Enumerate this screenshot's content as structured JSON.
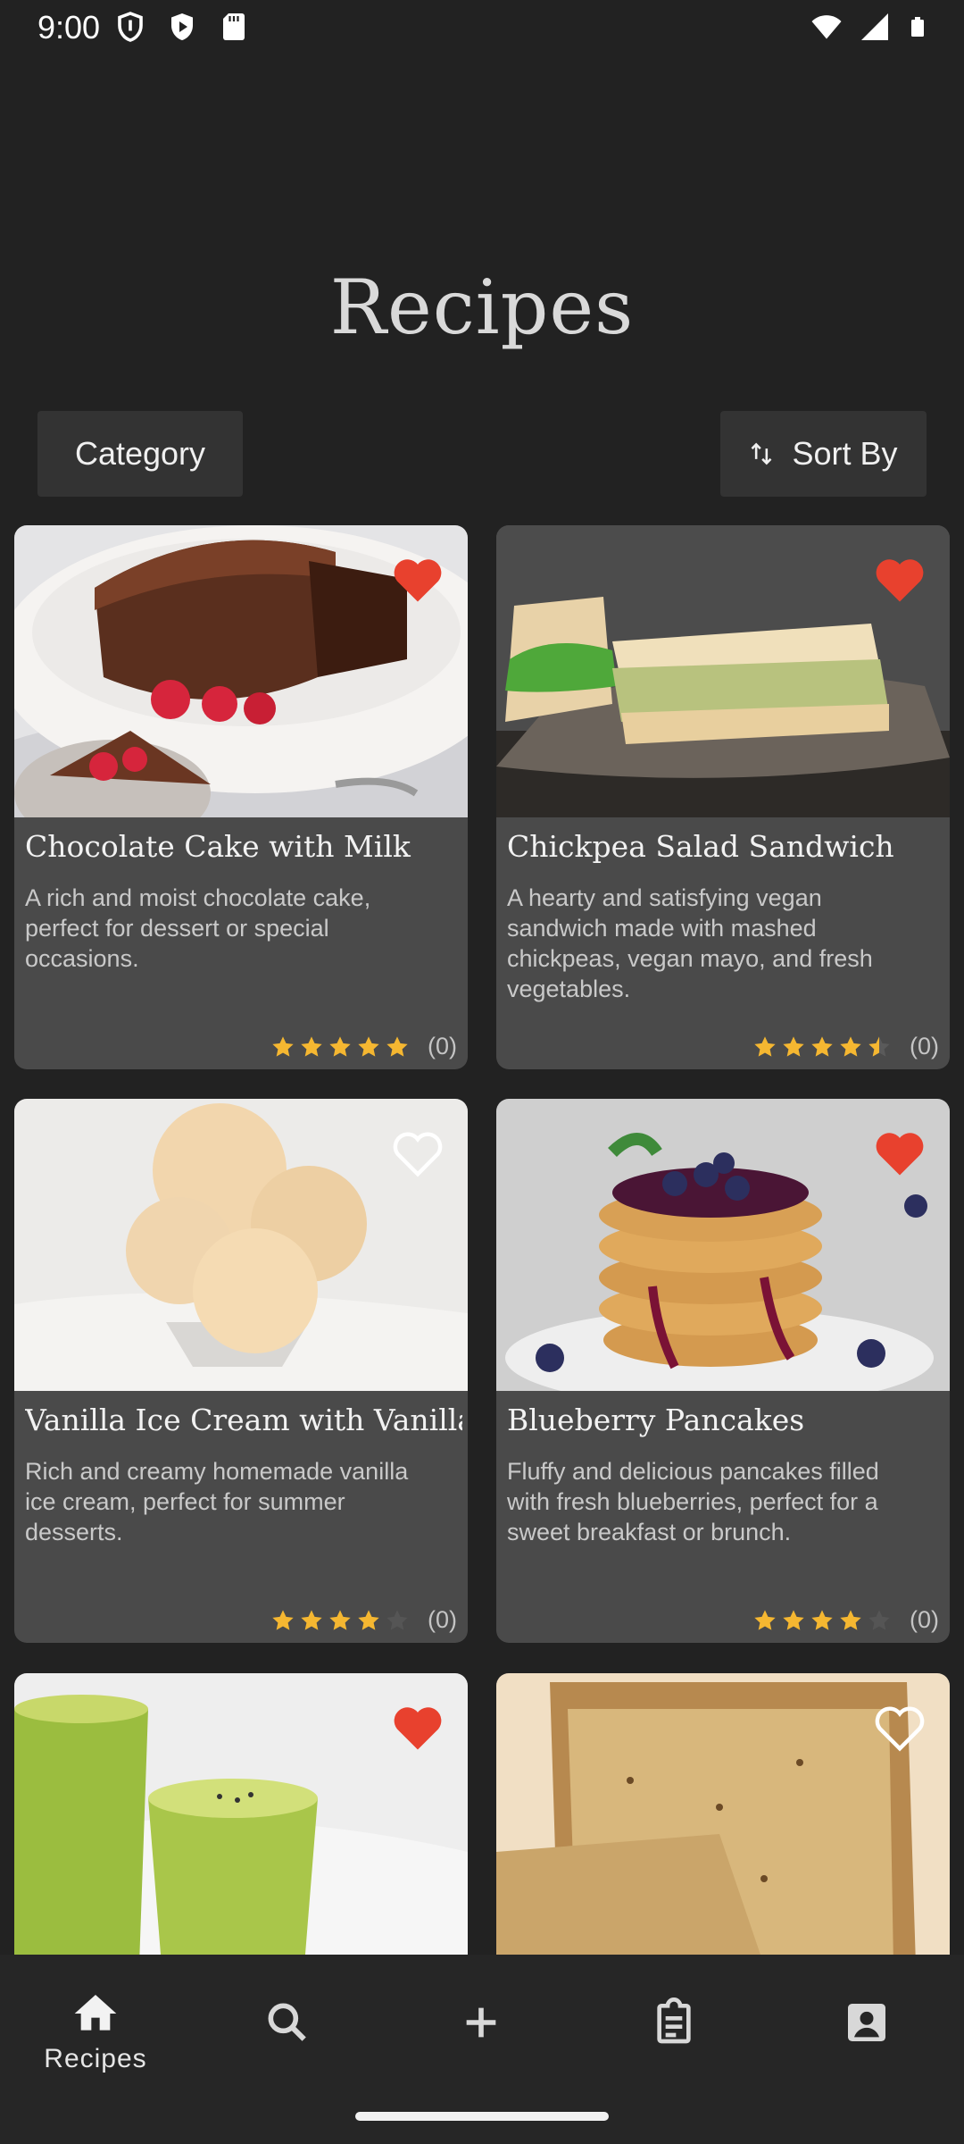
{
  "status": {
    "time": "9:00"
  },
  "header": {
    "title": "Recipes"
  },
  "filters": {
    "category_label": "Category",
    "sort_label": "Sort By"
  },
  "recipes": [
    {
      "title": "Chocolate Cake with Milk",
      "description": "A rich and moist chocolate cake, perfect for dessert or special occasions.",
      "rating": 5,
      "count": "(0)",
      "favorite": true,
      "image": "chocolate-cake"
    },
    {
      "title": "Chickpea Salad Sandwich",
      "description": "A hearty and satisfying vegan sandwich made with mashed chickpeas, vegan mayo, and fresh vegetables.",
      "rating": 4.5,
      "count": "(0)",
      "favorite": true,
      "image": "sandwich"
    },
    {
      "title": "Vanilla Ice Cream with Vanilla",
      "description": "Rich and creamy homemade vanilla ice cream, perfect for summer desserts.",
      "rating": 4,
      "count": "(0)",
      "favorite": false,
      "image": "ice-cream"
    },
    {
      "title": "Blueberry Pancakes",
      "description": "Fluffy and delicious pancakes filled with fresh blueberries, perfect for a sweet breakfast or brunch.",
      "rating": 4,
      "count": "(0)",
      "favorite": true,
      "image": "pancakes"
    },
    {
      "title": "",
      "description": "",
      "rating": null,
      "count": "",
      "favorite": true,
      "image": "green-smoothie"
    },
    {
      "title": "",
      "description": "",
      "rating": null,
      "count": "",
      "favorite": false,
      "image": "banana-bread"
    }
  ],
  "nav": {
    "items": [
      {
        "label": "Recipes",
        "icon": "home-icon"
      },
      {
        "label": "",
        "icon": "search-icon"
      },
      {
        "label": "",
        "icon": "add-icon"
      },
      {
        "label": "",
        "icon": "clipboard-icon"
      },
      {
        "label": "",
        "icon": "account-icon"
      }
    ]
  },
  "colors": {
    "background": "#222222",
    "card": "#4a4a4a",
    "favorite": "#e8412e",
    "star": "#f5b731"
  }
}
